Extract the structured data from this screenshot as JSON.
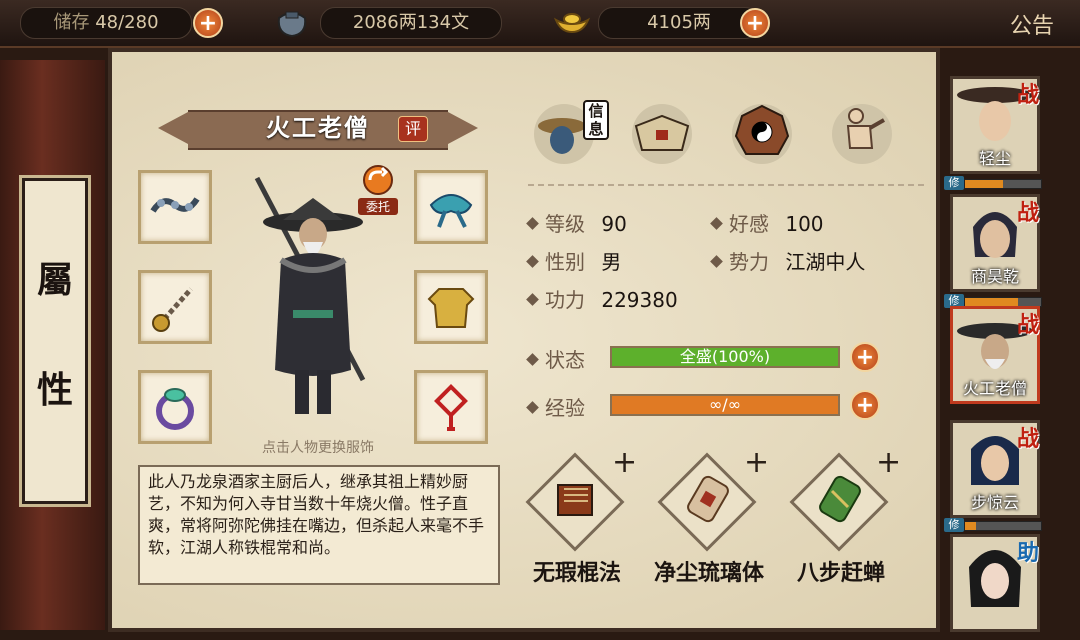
{
  "topbar": {
    "bag_label": "储存",
    "bag_count": "48/280",
    "coins": "2086两134文",
    "ingots": "4105两",
    "notice": "公告"
  },
  "sidebar": {
    "title_chars": [
      "屬",
      "性"
    ]
  },
  "character": {
    "name": "火工老僧",
    "rate_badge": "评",
    "commission_label": "委托",
    "change_outfit_hint": "点击人物更换服饰",
    "description": "此人乃龙泉酒家主厨后人，继承其祖上精妙厨艺，不知为何入寺甘当数十年烧火僧。性子直爽，常将阿弥陀佛挂在嘴边，但杀起人来毫不手软，江湖人称铁棍常和尚。"
  },
  "tabs": [
    {
      "label": "信息",
      "icon": "hat-icon"
    },
    {
      "label": "",
      "icon": "scroll-box-icon"
    },
    {
      "label": "",
      "icon": "bagua-icon"
    },
    {
      "label": "",
      "icon": "body-meridian-icon"
    }
  ],
  "stats": {
    "level_label": "等级",
    "level": "90",
    "favor_label": "好感",
    "favor": "100",
    "gender_label": "性别",
    "gender": "男",
    "faction_label": "势力",
    "faction": "江湖中人",
    "power_label": "功力",
    "power": "229380",
    "status_label": "状态",
    "status": "全盛(100%)",
    "status_fill": 1.0,
    "exp_label": "经验",
    "exp": "∞/∞",
    "exp_fill": 1.0
  },
  "skills": [
    {
      "name": "无瑕棍法",
      "plus": "+"
    },
    {
      "name": "净尘琉璃体",
      "plus": "+"
    },
    {
      "name": "八步赶蝉",
      "plus": "+"
    }
  ],
  "roster": [
    {
      "name": "轻尘",
      "tag": "战",
      "xiu": "修",
      "bar": 0.5
    },
    {
      "name": "商昊乾",
      "tag": "战",
      "xiu": "修",
      "bar": 0.7
    },
    {
      "name": "火工老僧",
      "tag": "战",
      "xiu": "",
      "bar": 0
    },
    {
      "name": "步惊云",
      "tag": "战",
      "xiu": "修",
      "bar": 0.15
    },
    {
      "name": "",
      "tag": "助",
      "xiu": "",
      "bar": 0
    }
  ],
  "colors": {
    "status_bar": "#5db02c",
    "exp_bar": "#e07a24",
    "accent_red": "#c03a1e"
  }
}
